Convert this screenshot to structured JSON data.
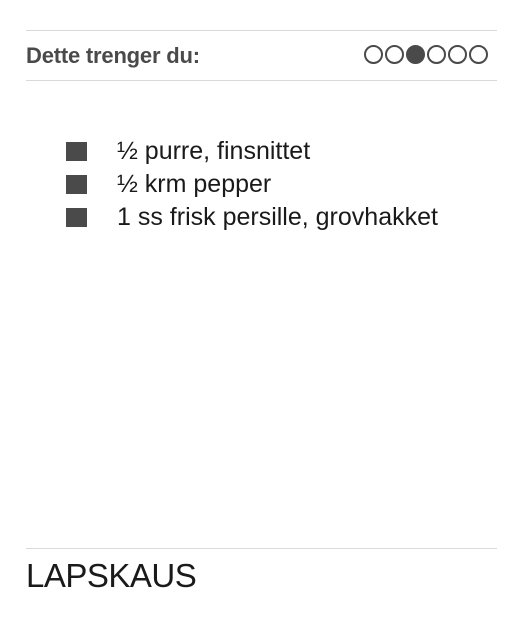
{
  "header": {
    "title": "Dette trenger du:"
  },
  "pager": {
    "total": 6,
    "current_index": 2,
    "color": "#4a4a4a"
  },
  "ingredients": [
    {
      "text": "½ purre, finsnittet"
    },
    {
      "text": "½ krm pepper"
    },
    {
      "text": "1 ss frisk persille, grovhakket"
    }
  ],
  "recipe": {
    "title": "LAPSKAUS"
  },
  "colors": {
    "text": "#1a1a1a",
    "accent": "#4a4a4a",
    "divider": "#d9d9d9",
    "background": "#ffffff"
  }
}
